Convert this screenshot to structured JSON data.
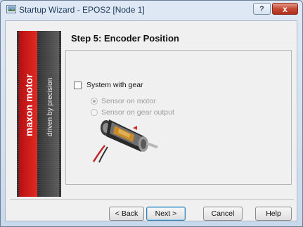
{
  "window": {
    "title": "Startup Wizard - EPOS2 [Node 1]",
    "help_label": "?",
    "close_label": "x"
  },
  "banner": {
    "brand": "maxon motor",
    "tagline": "driven by precision",
    "accent": "#d21a1a"
  },
  "step": {
    "title": "Step 5: Encoder Position"
  },
  "options": {
    "gear_checkbox_label": "System with gear",
    "gear_checked": false,
    "radio_motor_label": "Sensor on motor",
    "radio_gear_label": "Sensor on gear output",
    "selected": "Sensor on motor"
  },
  "buttons": {
    "back": "< Back",
    "next": "Next >",
    "cancel": "Cancel",
    "help": "Help"
  }
}
